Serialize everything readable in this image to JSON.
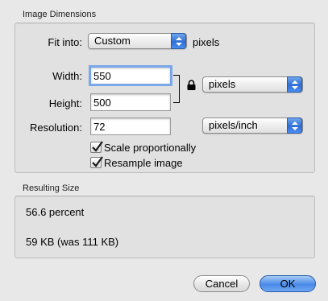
{
  "image_dimensions": {
    "title": "Image Dimensions",
    "fit_into": {
      "label": "Fit into:",
      "value": "Custom",
      "unit": "pixels"
    },
    "width": {
      "label": "Width:",
      "value": "550"
    },
    "height": {
      "label": "Height:",
      "value": "500"
    },
    "size_unit": "pixels",
    "resolution": {
      "label": "Resolution:",
      "value": "72",
      "unit": "pixels/inch"
    },
    "scale_proportionally": {
      "label": "Scale proportionally",
      "checked": true
    },
    "resample_image": {
      "label": "Resample image",
      "checked": true
    }
  },
  "resulting_size": {
    "title": "Resulting Size",
    "percent": "56.6 percent",
    "file_size": "59 KB (was 111 KB)"
  },
  "buttons": {
    "cancel": "Cancel",
    "ok": "OK"
  },
  "colors": {
    "accent": "#2f6fd6",
    "focus_ring": "#7aa7e9"
  }
}
